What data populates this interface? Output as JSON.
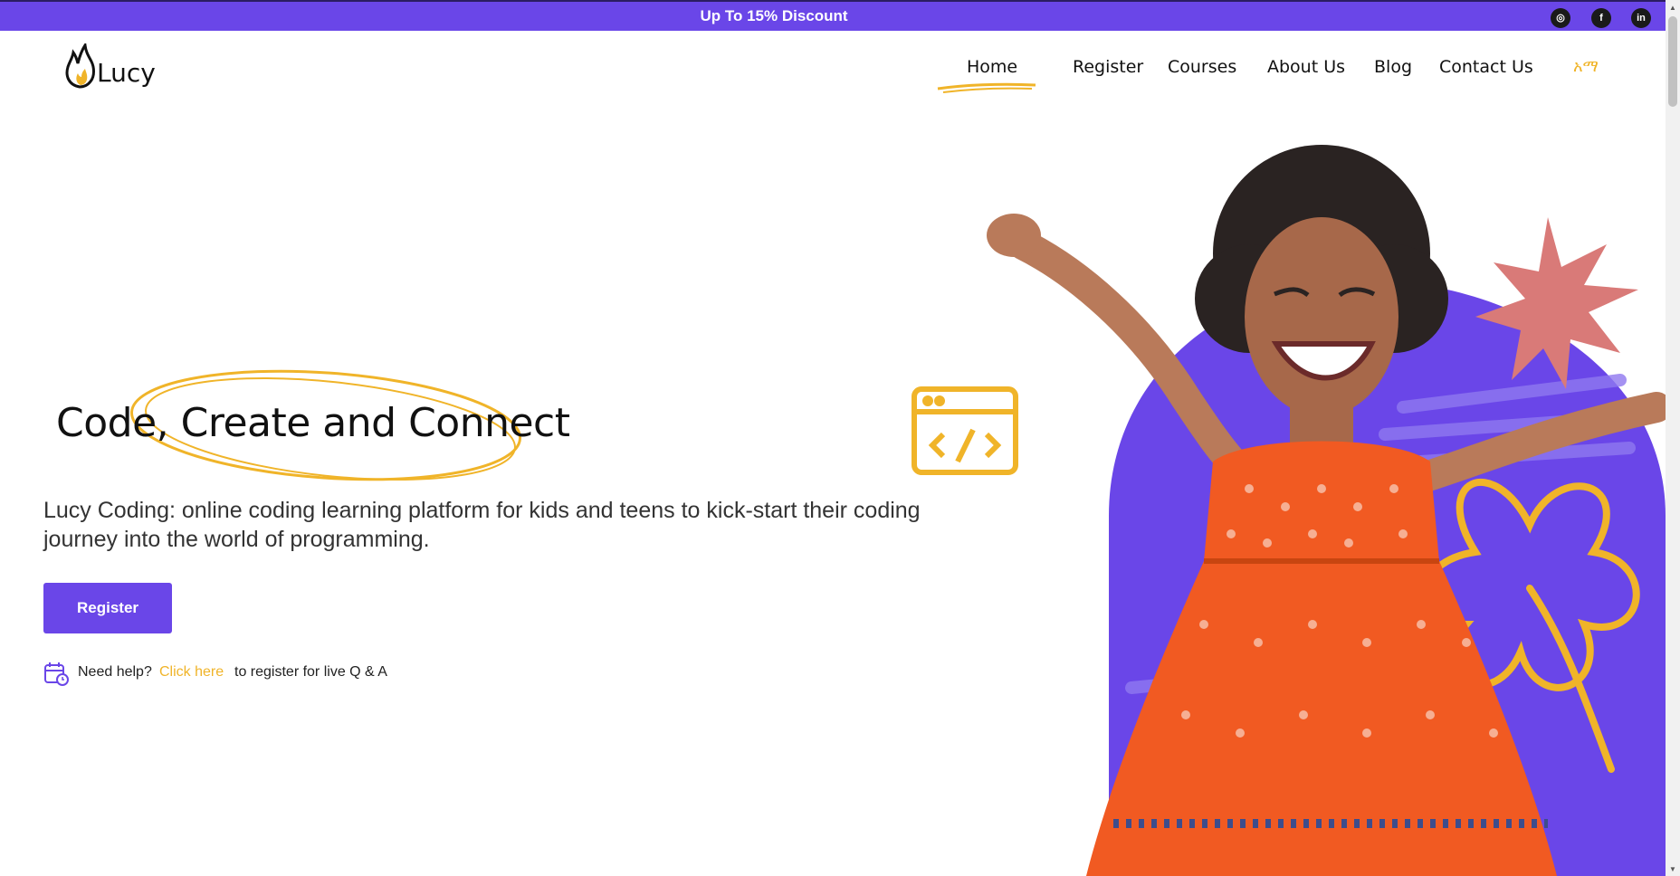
{
  "colors": {
    "accent": "#6a46e8",
    "highlight": "#f0b429",
    "text": "#111111"
  },
  "topbar": {
    "promo": "Up To 15% Discount",
    "social": [
      {
        "name": "instagram-icon",
        "glyph": "◎"
      },
      {
        "name": "facebook-icon",
        "glyph": "f"
      },
      {
        "name": "linkedin-icon",
        "glyph": "in"
      }
    ]
  },
  "logo": {
    "text": "Lucy"
  },
  "nav": {
    "items": [
      "Home",
      "Register",
      "Courses",
      "About Us",
      "Blog",
      "Contact Us"
    ],
    "active": "Home",
    "language": "አማ"
  },
  "hero": {
    "title": "Code, Create and Connect",
    "description": "Lucy Coding: online coding learning platform for kids and teens to kick-start their coding journey into the world of programming.",
    "register_button": "Register",
    "help_prefix": "Need help?",
    "help_link": "Click here",
    "help_suffix": "to register for live Q & A"
  }
}
